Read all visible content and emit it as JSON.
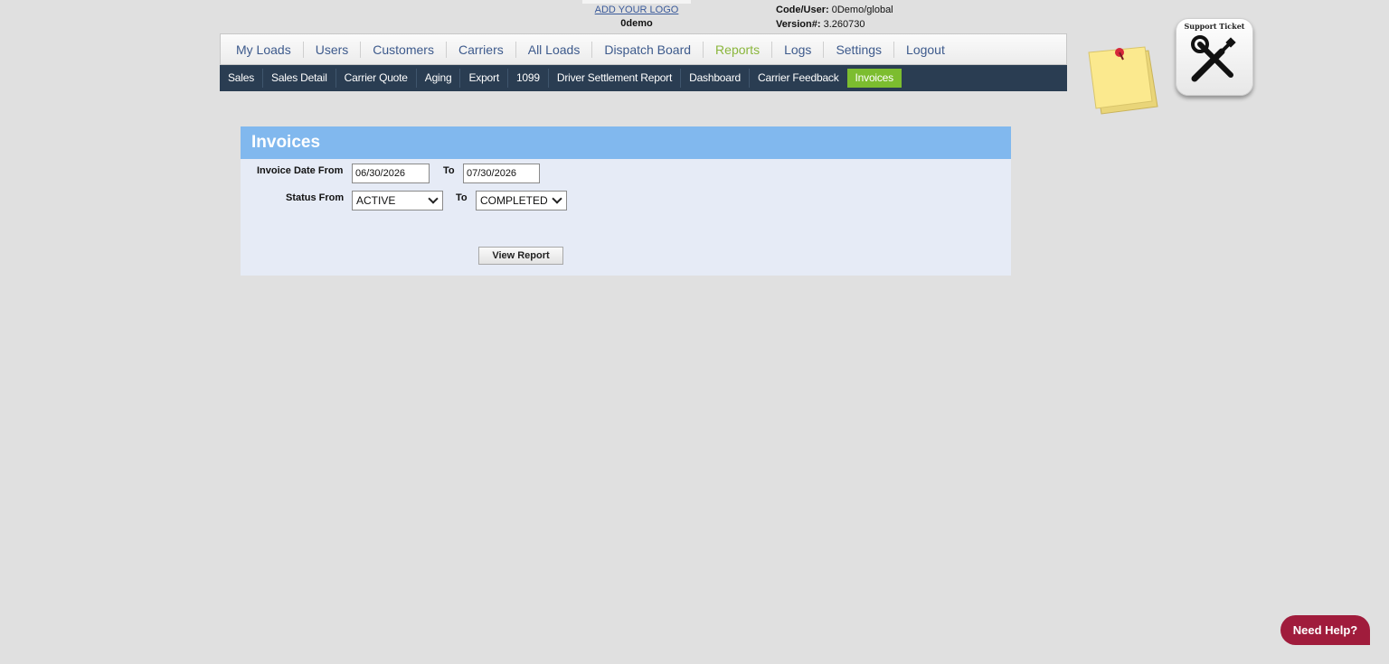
{
  "header": {
    "logo_link": "ADD YOUR LOGO",
    "company": "0demo",
    "code_user_label": "Code/User:",
    "code_user_value": "0Demo/global",
    "version_label": "Version#:",
    "version_value": "3.260730"
  },
  "main_nav": {
    "items": [
      "My Loads",
      "Users",
      "Customers",
      "Carriers",
      "All Loads",
      "Dispatch Board",
      "Reports",
      "Logs",
      "Settings",
      "Logout"
    ],
    "active": "Reports"
  },
  "sub_nav": {
    "items": [
      "Sales",
      "Sales Detail",
      "Carrier Quote",
      "Aging",
      "Export",
      "1099",
      "Driver Settlement Report",
      "Dashboard",
      "Carrier Feedback",
      "Invoices"
    ],
    "active": "Invoices"
  },
  "panel": {
    "title": "Invoices",
    "date_from_label": "Invoice Date From",
    "date_from_value": "06/30/2026",
    "to_label": "To",
    "date_to_value": "07/30/2026",
    "status_from_label": "Status From",
    "status_from_value": "ACTIVE",
    "status_to_label": "To",
    "status_to_value": "COMPLETED",
    "view_button": "View Report"
  },
  "support": {
    "label": "Support Ticket"
  },
  "help": {
    "label": "Need Help?"
  },
  "colors": {
    "accent_green": "#7cbd2f",
    "nav_dark": "#2a3d52",
    "panel_blue": "#81b8ee",
    "help_red": "#a01c3c"
  }
}
